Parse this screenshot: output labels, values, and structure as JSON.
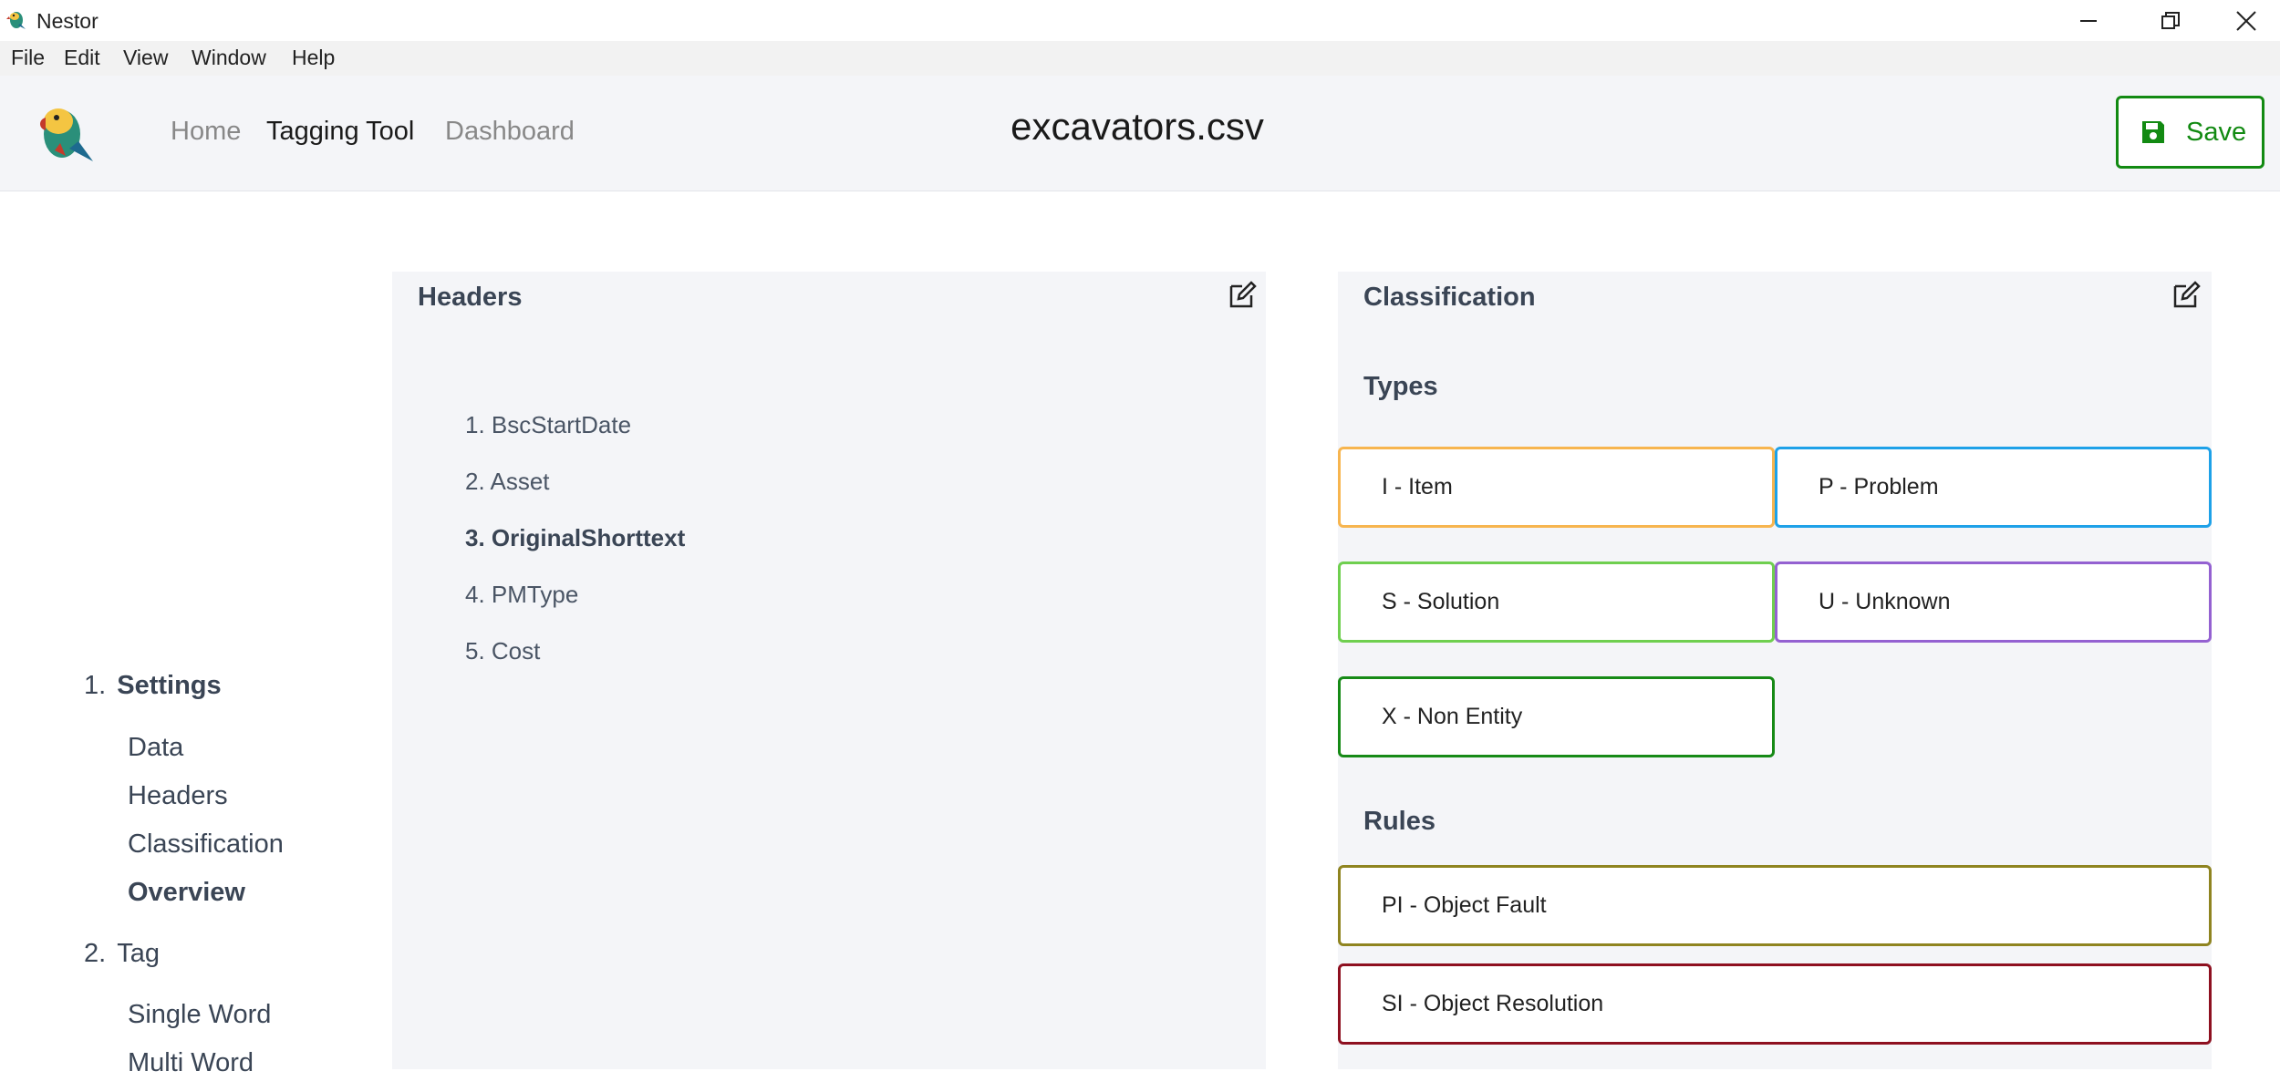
{
  "window": {
    "title": "Nestor",
    "controls": {
      "minimize_icon": "minimize-icon",
      "maximize_icon": "restore-icon",
      "close_icon": "close-icon"
    }
  },
  "menu": [
    "File",
    "Edit",
    "View",
    "Window",
    "Help"
  ],
  "header": {
    "nav": [
      {
        "label": "Home",
        "active": false
      },
      {
        "label": "Tagging Tool",
        "active": true
      },
      {
        "label": "Dashboard",
        "active": false
      }
    ],
    "filename": "excavators.csv",
    "save_label": "Save"
  },
  "sidebar": {
    "step1": {
      "number": "1.",
      "label": "Settings"
    },
    "step1_items": [
      "Data",
      "Headers",
      "Classification",
      "Overview"
    ],
    "step2": {
      "number": "2.",
      "label": "Tag"
    },
    "step2_items": [
      "Single Word",
      "Multi Word"
    ]
  },
  "headers_panel": {
    "title": "Headers",
    "items": [
      "1. BscStartDate",
      "2. Asset",
      "3. OriginalShorttext",
      "4. PMType",
      "5. Cost"
    ],
    "selected_index": 2
  },
  "classification_panel": {
    "title": "Classification",
    "types_title": "Types",
    "types": [
      {
        "label": "I - Item",
        "color": "#f7b54f"
      },
      {
        "label": "P - Problem",
        "color": "#1ea1e8"
      },
      {
        "label": "S - Solution",
        "color": "#6fcf4f"
      },
      {
        "label": "U - Unknown",
        "color": "#9461d1"
      },
      {
        "label": "X - Non Entity",
        "color": "#168a16"
      }
    ],
    "rules_title": "Rules",
    "rules": [
      {
        "label": "PI - Object Fault",
        "color": "#8f8420"
      },
      {
        "label": "SI - Object Resolution",
        "color": "#8e1020"
      }
    ]
  },
  "colors": {
    "accent_green": "#128a12",
    "panel_bg": "#f4f5f8",
    "text": "#3a4555"
  }
}
